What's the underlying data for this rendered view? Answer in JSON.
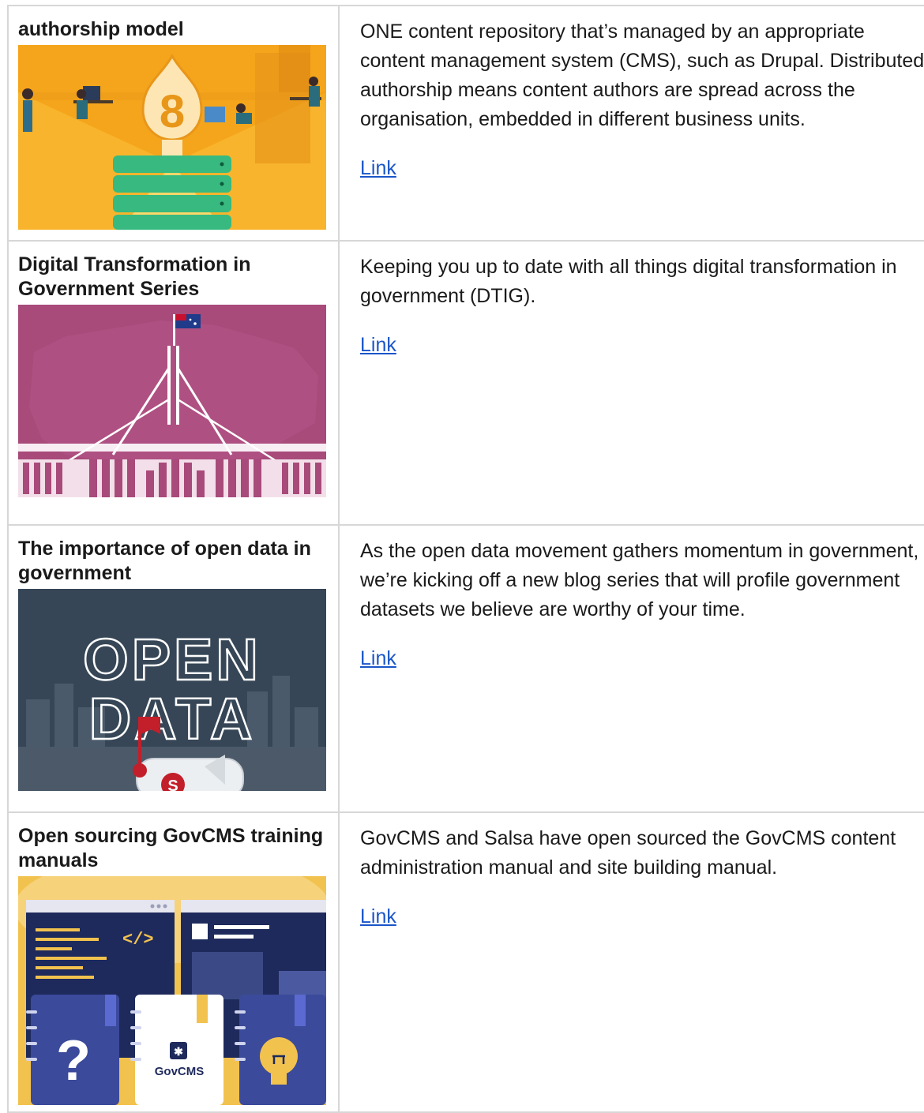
{
  "rows": [
    {
      "title": "authorship model",
      "description": "ONE content repository that’s managed by an appropriate content management system (CMS), such as Drupal. Distributed authorship means content authors are spread across the organisation, embedded in different business units.",
      "link_label": "Link",
      "thumbnail": "drupal-8-illustration"
    },
    {
      "title": "Digital Transformation in Government Series",
      "description": "Keeping you up to date with all things digital transformation in government (DTIG).",
      "link_label": "Link",
      "thumbnail": "parliament-house-illustration"
    },
    {
      "title": "The importance of open data in government",
      "description": "As the open data movement gathers momentum in government, we’re kicking off a new blog series that will profile government datasets we believe are worthy of your time.",
      "link_label": "Link",
      "thumbnail": "open-data-illustration",
      "thumbnail_text": [
        "OPEN",
        "DATA"
      ],
      "badge_letter": "S"
    },
    {
      "title": "Open sourcing GovCMS training manuals",
      "description": "GovCMS and Salsa have open sourced the GovCMS content administration manual and site building manual.",
      "link_label": "Link",
      "thumbnail": "govcms-manuals-illustration",
      "thumbnail_text": {
        "code": "</>",
        "question": "?",
        "brand": "GovCMS"
      }
    }
  ],
  "colors": {
    "link": "#1a55c9",
    "border": "#d7d7d7",
    "drupal_bg": "#f5a51b",
    "parliament_bg": "#a84a7a",
    "open_data_bg": "#364656",
    "govcms_bg": "#f2c24f",
    "navy": "#1e2a5c"
  }
}
